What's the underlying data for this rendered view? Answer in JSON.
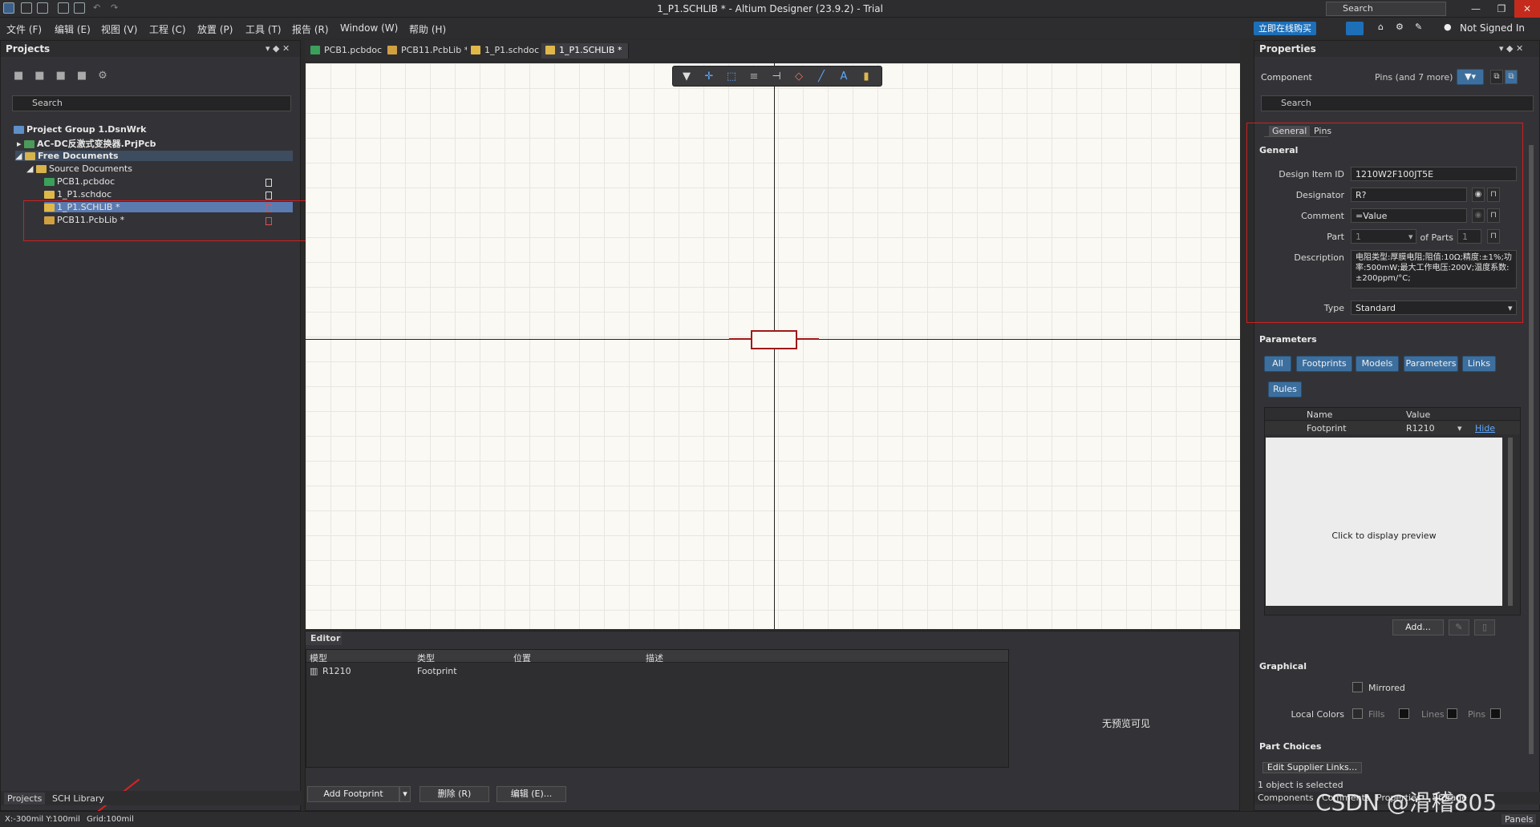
{
  "titlebar": {
    "title": "1_P1.SCHLIB * - Altium Designer (23.9.2) - Trial",
    "search": "Search",
    "min": "—",
    "restore": "❐",
    "close": "✕"
  },
  "menubar": {
    "items": [
      "文件 (F)",
      "编辑 (E)",
      "视图 (V)",
      "工程 (C)",
      "放置 (P)",
      "工具 (T)",
      "报告 (R)",
      "Window (W)",
      "帮助 (H)"
    ],
    "buy": "立即在线购买",
    "not_signed": "Not Signed In"
  },
  "projects": {
    "header": "Projects",
    "search": "Search",
    "tree": [
      {
        "label": "Project Group 1.DsnWrk",
        "color": "#5f8fc7"
      },
      {
        "label": "AC-DC反激式变换器.PrjPcb",
        "color": "#4a9a5a"
      },
      {
        "label": "Free Documents",
        "color": "#d8b24a"
      },
      {
        "label": "Source Documents",
        "color": "#d8b24a"
      },
      {
        "label": "PCB1.pcbdoc",
        "color": "#3aa05a"
      },
      {
        "label": "1_P1.schdoc",
        "color": "#e0b84a"
      },
      {
        "label": "1_P1.SCHLIB *",
        "color": "#e0b84a"
      },
      {
        "label": "PCB11.PcbLib *",
        "color": "#d0a040"
      }
    ],
    "bottom_tabs": [
      "Projects",
      "SCH Library"
    ]
  },
  "doc_tabs": [
    "PCB1.pcbdoc",
    "PCB11.PcbLib *",
    "1_P1.schdoc",
    "1_P1.SCHLIB *"
  ],
  "editor": {
    "header": "Editor",
    "columns": [
      "模型",
      "类型",
      "位置",
      "描述"
    ],
    "rows": [
      {
        "model": "R1210",
        "type": "Footprint",
        "pos": "",
        "desc": ""
      }
    ],
    "no_preview": "无预览可见",
    "add_footprint": "Add Footprint",
    "delete": "删除 (R)",
    "edit": "编辑 (E)..."
  },
  "status": {
    "coords": "X:-300mil Y:100mil",
    "grid": "Grid:100mil"
  },
  "properties": {
    "header": "Properties",
    "component": "Component",
    "filter": "Pins (and 7 more)",
    "search": "Search",
    "tabs": [
      "General",
      "Pins"
    ],
    "general": {
      "title": "General",
      "design_item_label": "Design Item ID",
      "design_item": "1210W2F100JT5E",
      "designator_label": "Designator",
      "designator": "R?",
      "comment_label": "Comment",
      "comment": "=Value",
      "part_label": "Part",
      "part": "1",
      "of_parts": "of Parts",
      "of_parts_val": "1",
      "desc_label": "Description",
      "description": "电阻类型:厚膜电阻;阻值:10Ω;精度:±1%;功率:500mW;最大工作电压:200V;温度系数:±200ppm/°C;",
      "type_label": "Type",
      "type": "Standard"
    },
    "parameters": {
      "title": "Parameters",
      "buttons": [
        "All",
        "Footprints",
        "Models",
        "Parameters",
        "Links",
        "Rules"
      ],
      "col_name": "Name",
      "col_value": "Value",
      "row_name": "Footprint",
      "row_value": "R1210",
      "hide": "Hide",
      "preview": "Click to display preview",
      "add": "Add..."
    },
    "graphical": {
      "title": "Graphical",
      "mirrored": "Mirrored",
      "local_colors": "Local Colors",
      "fills": "Fills",
      "lines": "Lines",
      "pins": "Pins"
    },
    "part_choices": {
      "title": "Part Choices",
      "edit_links": "Edit Supplier Links..."
    },
    "selected": "1 object is selected",
    "bottom_tabs": [
      "Components",
      "Comments",
      "Properties",
      "Storage"
    ],
    "panels": "Panels"
  },
  "watermark": "CSDN @滑稽805"
}
